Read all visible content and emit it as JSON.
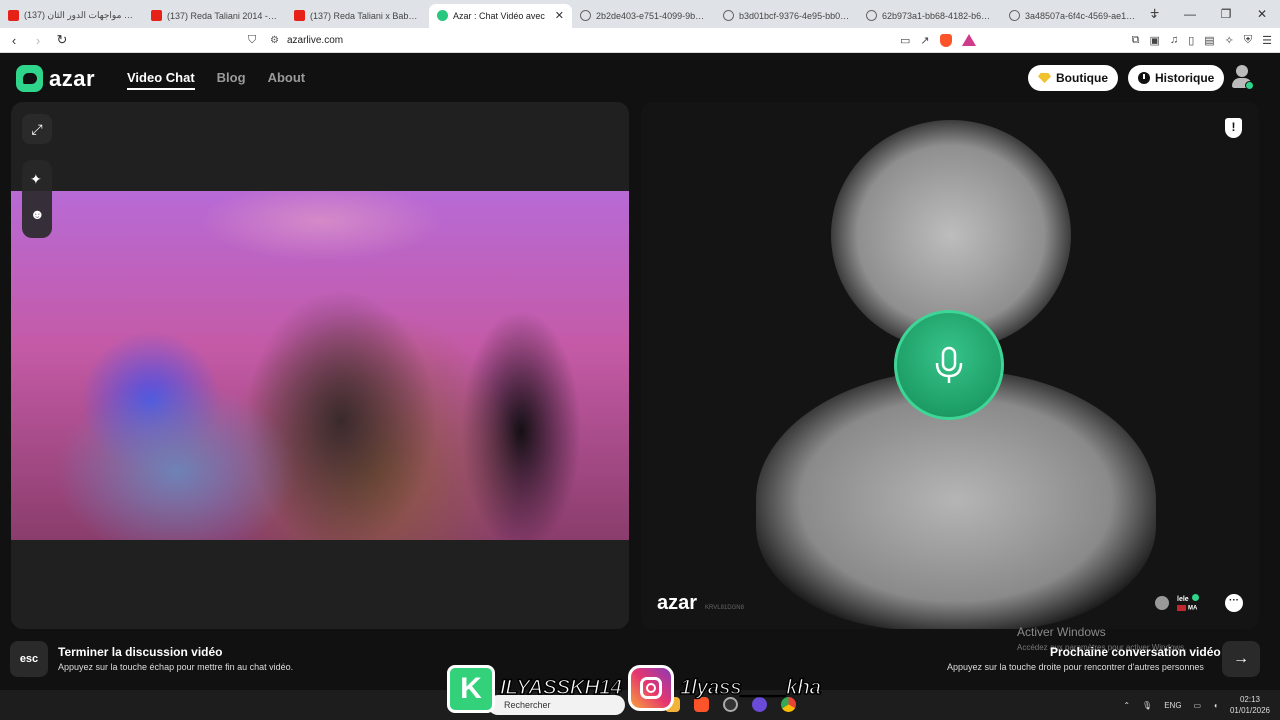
{
  "browser": {
    "tabs": [
      {
        "title": "(137) رسميا مواجهات الدور الثان",
        "favicon": "youtube"
      },
      {
        "title": "(137) Reda Taliani 2014 - Safin",
        "favicon": "youtube"
      },
      {
        "title": "(137) Reda Taliani x Baby gang",
        "favicon": "youtube"
      },
      {
        "title": "Azar : Chat Vidéo avec",
        "favicon": "azar",
        "active": true
      },
      {
        "title": "2b2de403-e751-4099-9b9b-2",
        "favicon": "globe"
      },
      {
        "title": "b3d01bcf-9376-4e95-bb09-9",
        "favicon": "globe"
      },
      {
        "title": "62b973a1-bb68-4182-b6d7-0",
        "favicon": "globe"
      },
      {
        "title": "3a48507a-6f4c-4569-ae1f-bf",
        "favicon": "globe"
      }
    ],
    "url": "azarlive.com",
    "brave_badge": "8"
  },
  "app": {
    "logo_text": "azar",
    "nav": [
      {
        "label": "Video Chat",
        "active": true
      },
      {
        "label": "Blog"
      },
      {
        "label": "About"
      }
    ],
    "boutique_label": "Boutique",
    "historique_label": "Historique"
  },
  "remote": {
    "watermark": "azar",
    "watermark_id": "KRVL81DGN8",
    "peer_name": "lele",
    "peer_country": "MA"
  },
  "footer": {
    "esc_label": "esc",
    "end_title": "Terminer la discussion vidéo",
    "end_sub": "Appuyez sur la touche échap pour mettre fin au chat vidéo.",
    "next_title": "Prochaine conversation vidéo",
    "next_sub": "Appuyez sur la touche droite pour rencontrer d'autres personnes"
  },
  "windows": {
    "activate_title": "Activer Windows",
    "activate_sub": "Accédez aux paramètres pour activer Windows.",
    "search_placeholder": "Rechercher",
    "lang": "ENG",
    "time": "02:13",
    "date": "01/01/2026"
  },
  "overlay": {
    "kick_handle": "ILYASSKH14",
    "insta_handle": "1lyass____kha"
  },
  "colors": {
    "accent": "#2fd58a",
    "mic": "#1e9e67"
  }
}
